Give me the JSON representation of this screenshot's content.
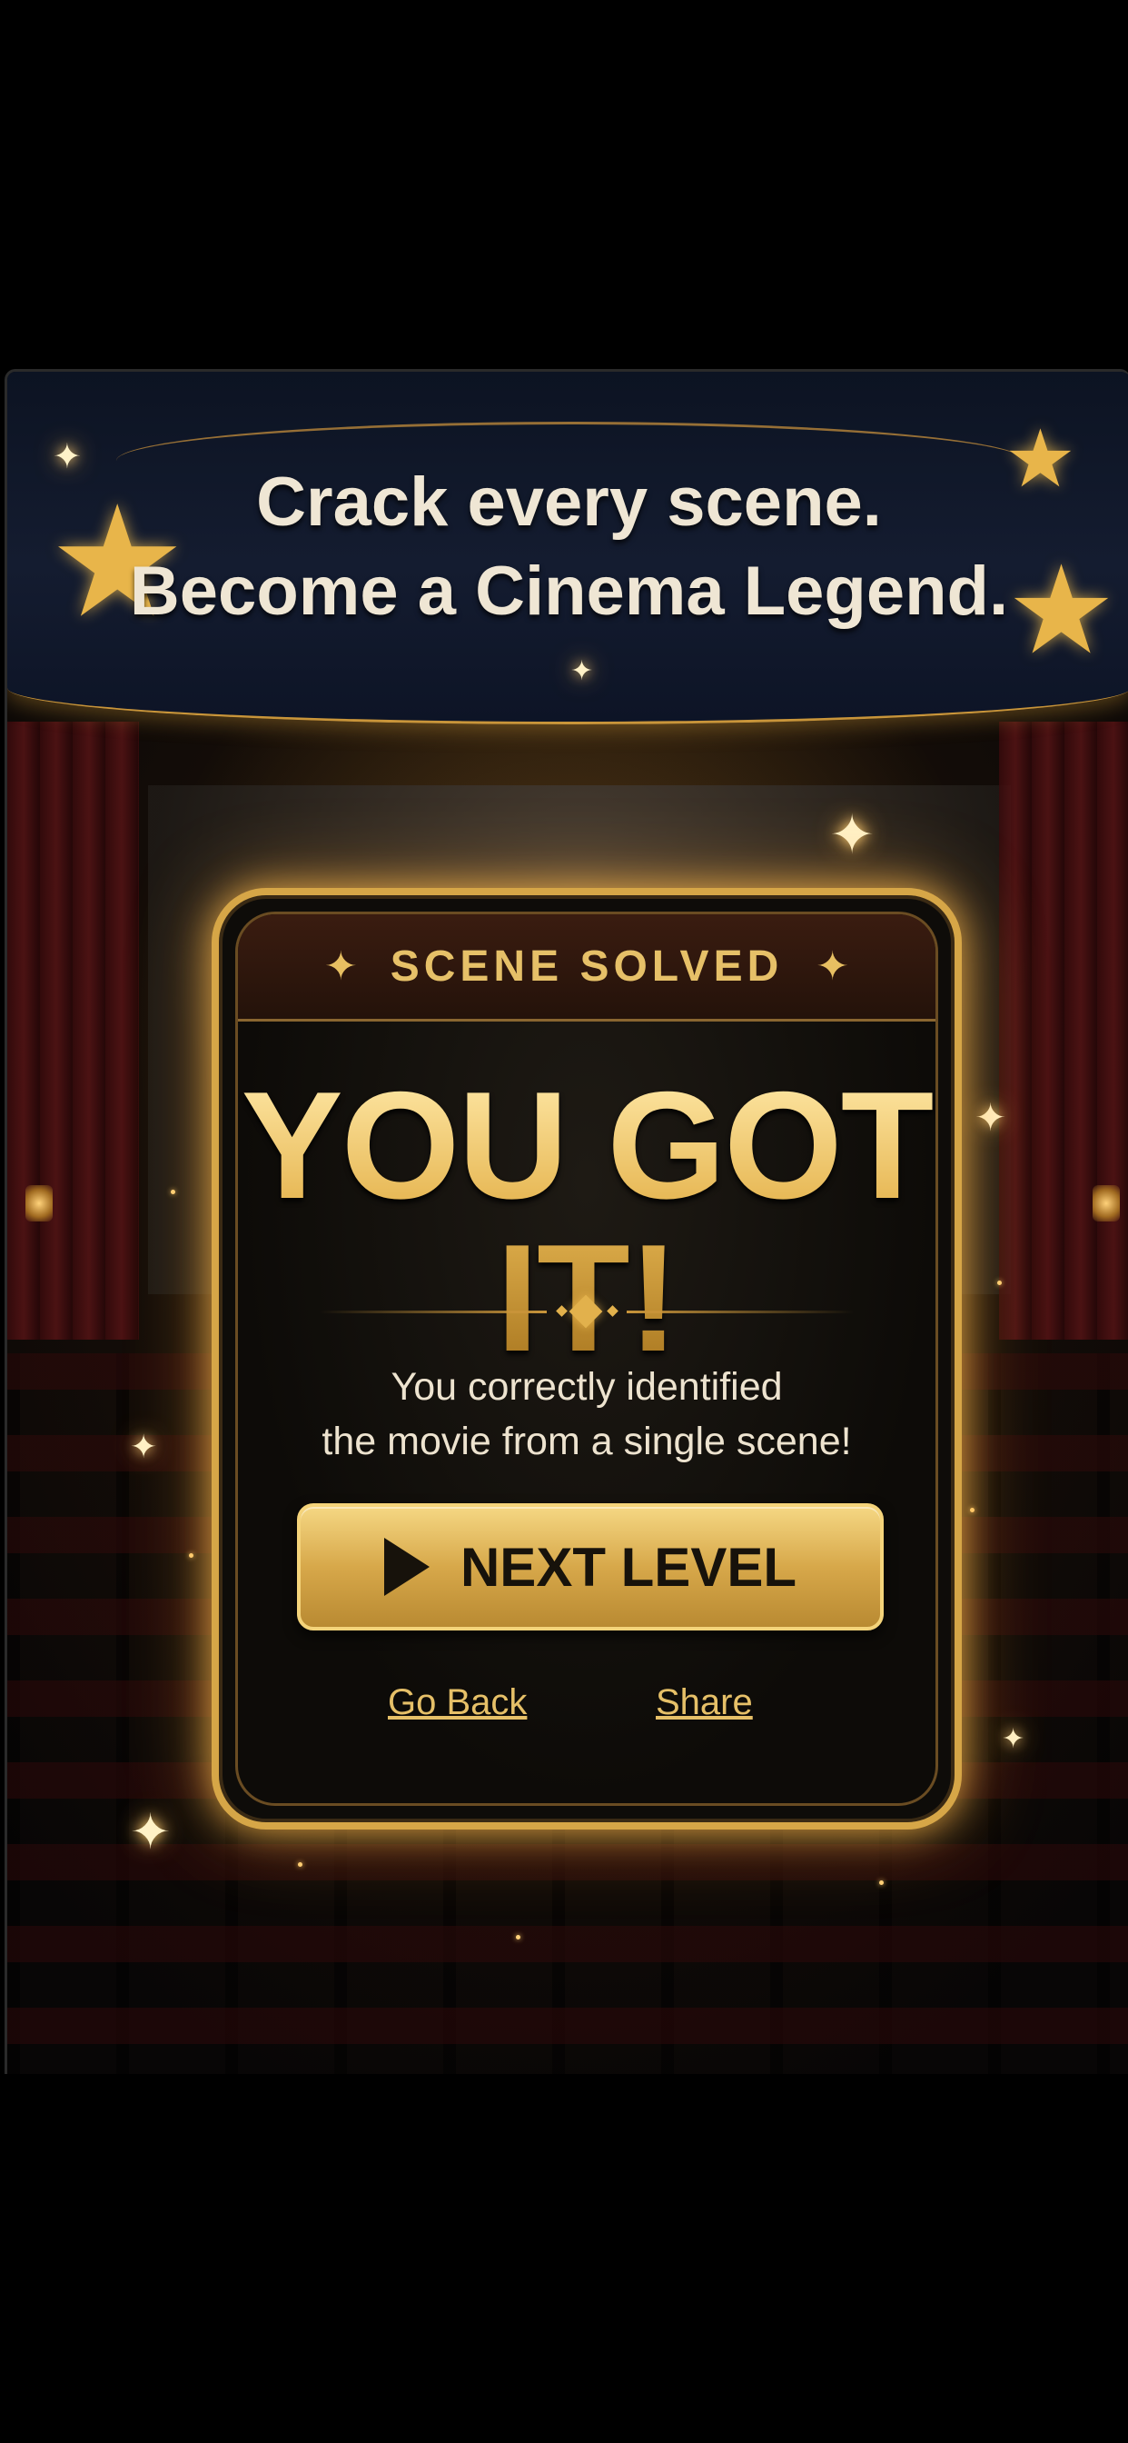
{
  "banner": {
    "tagline_line1": "Crack every scene.",
    "tagline_line2": "Become a Cinema Legend."
  },
  "result_card": {
    "header_label": "SCENE SOLVED",
    "headline": "YOU GOT IT!",
    "message_line1": "You correctly identified",
    "message_line2": "the movie from a single scene!",
    "next_button_label": "NEXT LEVEL",
    "go_back_label": "Go Back",
    "share_label": "Share"
  },
  "colors": {
    "gold": "#e2b14c",
    "banner_navy": "#141c30",
    "card_background": "#0e0c09",
    "curtain_red": "#5a1416"
  },
  "icons": {
    "next_button_icon": "play-icon",
    "header_decoration": "sparkle-star-icon",
    "banner_decoration": "star-icon"
  }
}
